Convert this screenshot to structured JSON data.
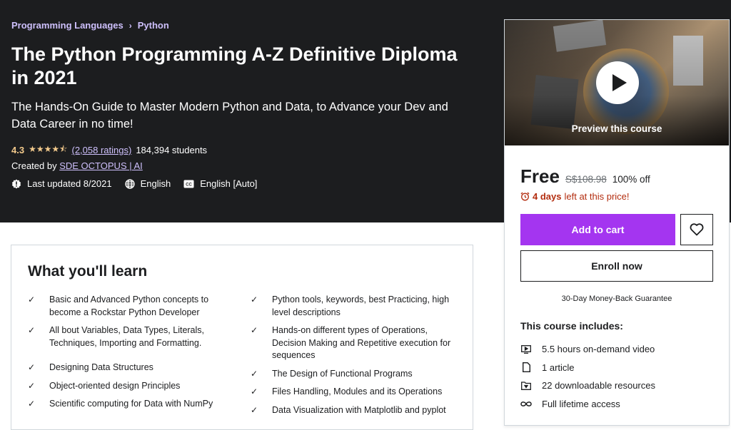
{
  "breadcrumb": [
    "Programming Languages",
    "Python"
  ],
  "course": {
    "title": "The Python Programming A-Z Definitive Diploma in 2021",
    "subtitle": "The Hands-On Guide to Master Modern Python and Data, to Advance your Dev and Data Career in no time!",
    "rating": "4.3",
    "stars": "★★★★⯪",
    "rating_value": 4.3,
    "ratings_count": "(2,058 ratings)",
    "students": "184,394 students",
    "created_by_label": "Created by",
    "instructor": "SDE OCTOPUS | AI",
    "last_updated": "Last updated 8/2021",
    "language": "English",
    "captions": "English [Auto]"
  },
  "sidebar": {
    "preview_label": "Preview this course",
    "price": "Free",
    "original_price": "S$108.98",
    "discount": "100% off",
    "timer_bold": "4 days",
    "timer_rest": " left at this price!",
    "add_to_cart": "Add to cart",
    "enroll_now": "Enroll now",
    "guarantee": "30-Day Money-Back Guarantee",
    "includes_title": "This course includes:",
    "includes": [
      {
        "icon": "video-icon",
        "text": "5.5 hours on-demand video"
      },
      {
        "icon": "file-icon",
        "text": "1 article"
      },
      {
        "icon": "folder-download-icon",
        "text": "22 downloadable resources"
      },
      {
        "icon": "infinity-icon",
        "text": "Full lifetime access"
      }
    ]
  },
  "learn": {
    "title": "What you'll learn",
    "left": [
      "Basic and Advanced Python concepts to become a Rockstar Python Developer",
      "All bout Variables, Data Types, Literals, Techniques, Importing and Formatting.",
      "Designing Data Structures",
      "Object-oriented design Principles",
      "Scientific computing for Data with NumPy"
    ],
    "right": [
      "Python tools, keywords, best Practicing, high level descriptions",
      "Hands-on different types of Operations, Decision Making and Repetitive execution for sequences",
      "The Design of Functional Programs",
      "Files Handling, Modules and its Operations",
      "Data Visualization with Matplotlib and pyplot"
    ]
  },
  "colors": {
    "hero_bg": "#1c1d1f",
    "accent_purple": "#a435f0",
    "breadcrumb_link": "#cec0fc",
    "star_gold": "#f3ca8c",
    "timer_red": "#b32d0f"
  }
}
